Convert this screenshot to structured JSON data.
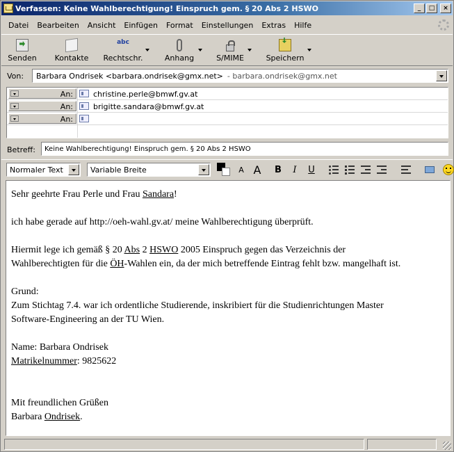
{
  "window": {
    "title": "Verfassen: Keine Wahlberechtigung! Einspruch gem. § 20 Abs 2 HSWO",
    "minimize": "_",
    "maximize": "□",
    "close": "×"
  },
  "menu": [
    {
      "label": "Datei"
    },
    {
      "label": "Bearbeiten"
    },
    {
      "label": "Ansicht"
    },
    {
      "label": "Einfügen"
    },
    {
      "label": "Format"
    },
    {
      "label": "Einstellungen"
    },
    {
      "label": "Extras"
    },
    {
      "label": "Hilfe"
    }
  ],
  "toolbar": {
    "send": "Senden",
    "contacts": "Kontakte",
    "spelling": "Rechtschr.",
    "spelling_icon_text": "abc",
    "attach": "Anhang",
    "smime": "S/MIME",
    "save": "Speichern"
  },
  "from": {
    "label": "Von:",
    "identity": "Barbara Ondrisek <barbara.ondrisek@gmx.net>",
    "account": "- barbara.ondrisek@gmx.net"
  },
  "recipients": [
    {
      "type": "An:",
      "address": "christine.perle@bmwf.gv.at"
    },
    {
      "type": "An:",
      "address": "brigitte.sandara@bmwf.gv.at"
    },
    {
      "type": "An:",
      "address": ""
    }
  ],
  "subject": {
    "label": "Betreff:",
    "value": "Keine Wahlberechtigung! Einspruch gem. § 20 Abs 2 HSWO"
  },
  "format": {
    "paragraph_style": "Normaler Text",
    "font": "Variable Breite",
    "text_color": "#000000",
    "bg_color": "#ffffff",
    "smaller": "A",
    "larger": "A",
    "bold": "B",
    "italic": "I",
    "underline": "U"
  },
  "body": {
    "greeting_a": "Sehr geehrte Frau Perle und Frau ",
    "greeting_name": "Sandara",
    "greeting_b": "!",
    "p1": "ich habe gerade auf http://oeh-wahl.gv.at/ meine Wahlberechtigung überprüft.",
    "p2_a": "Hiermit lege ich gemäß § 20 ",
    "p2_abs": "Abs",
    "p2_b": " 2 ",
    "p2_hswo": "HSWO",
    "p2_c": " 2005 Einspruch gegen das Verzeichnis der",
    "p2_line2_a": "Wahlberechtigten für die ",
    "p2_oeh": "ÖH",
    "p2_line2_b": "-Wahlen ein, da der mich betreffende Eintrag fehlt bzw. mangelhaft ist.",
    "grund_label": "Grund:",
    "grund_line1": "Zum Stichtag 7.4. war ich ordentliche Studierende, inskribiert für die Studienrichtungen Master",
    "grund_line2": "Software-Engineering an der TU Wien.",
    "name_line": "Name: Barbara Ondrisek",
    "matrikel_label": "Matrikelnummer",
    "matrikel_value": ": 9825622",
    "closing": "Mit freundlichen Grüßen",
    "signature_a": "Barbara ",
    "signature_b": "Ondrisek",
    "signature_c": "."
  }
}
